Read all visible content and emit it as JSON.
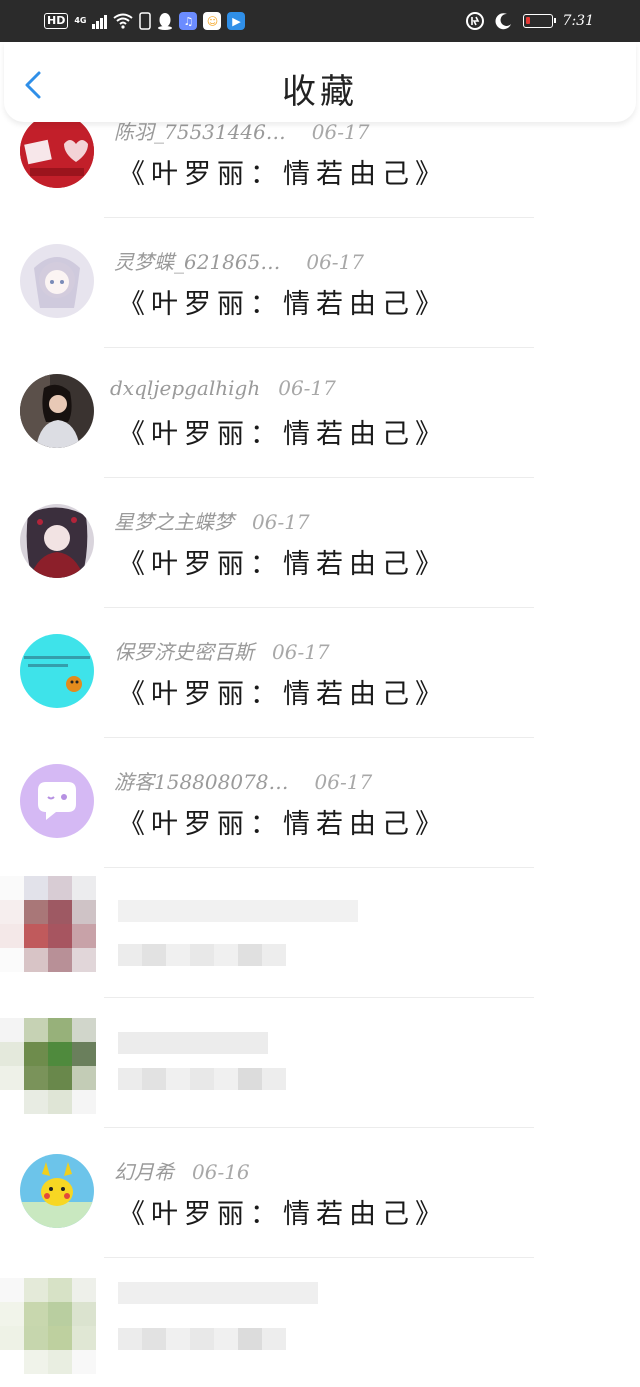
{
  "status_bar": {
    "hd": "HD",
    "network": "4G",
    "time": "7:31"
  },
  "header": {
    "title": "收藏"
  },
  "favorites": [
    {
      "name": "陈羽_75531446…",
      "date": "06-17",
      "content": "《叶罗丽：情若由己》"
    },
    {
      "name": "灵梦蝶_621865…",
      "date": "06-17",
      "content": "《叶罗丽：情若由己》"
    },
    {
      "name": "dxqljepgalhigh",
      "date": "06-17",
      "content": "《叶罗丽：情若由己》"
    },
    {
      "name": "星梦之主蝶梦",
      "date": "06-17",
      "content": "《叶罗丽：情若由己》"
    },
    {
      "name": "保罗济史密百斯",
      "date": "06-17",
      "content": "《叶罗丽：情若由己》"
    },
    {
      "name": "游客158808078…",
      "date": "06-17",
      "content": "《叶罗丽：情若由己》"
    },
    {
      "name": "幻月希",
      "date": "06-16",
      "content": "《叶罗丽：情若由己》"
    }
  ],
  "colors": {
    "accent": "#2f8fe8",
    "status_bar": "#2b2b2b",
    "name_gray": "#9a9a9a"
  }
}
